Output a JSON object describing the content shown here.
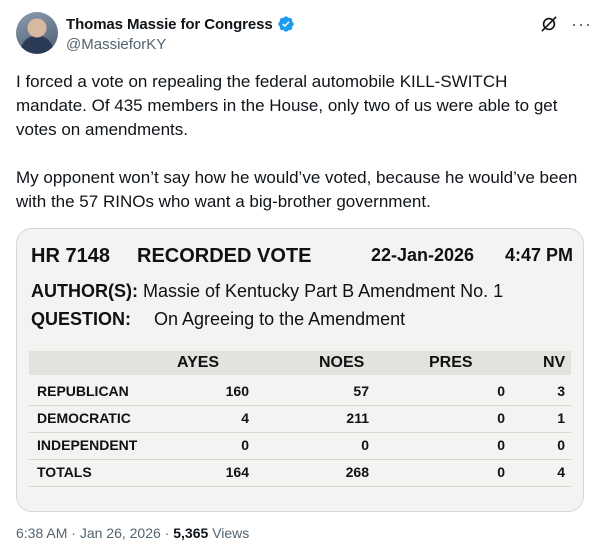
{
  "author": {
    "display_name": "Thomas Massie for Congress",
    "handle": "@MassieforKY",
    "verified_color": "#1d9bf0"
  },
  "icons": {
    "verified": "verified-badge-icon",
    "grok": "grok-icon",
    "more": "more-options-icon"
  },
  "tweet": {
    "paragraph1": "I forced a vote on repealing the federal automobile KILL-SWITCH mandate. Of 435 members in the House, only two of us were able to get votes on amendments.",
    "paragraph2": "My opponent won’t say how he would’ve voted, because he would’ve been with the 57 RINOs who want a big-brother government."
  },
  "vote_card": {
    "bill": "HR 7148",
    "title": "RECORDED VOTE",
    "date": "22-Jan-2026",
    "time": "4:47 PM",
    "author_label": "AUTHOR(S):",
    "author_value": "Massie of Kentucky Part B Amendment No. 1",
    "question_label": "QUESTION:",
    "question_value": "On Agreeing to the Amendment",
    "columns": [
      "AYES",
      "NOES",
      "PRES",
      "NV"
    ],
    "rows": [
      {
        "party": "REPUBLICAN",
        "ayes": "160",
        "noes": "57",
        "pres": "0",
        "nv": "3"
      },
      {
        "party": "DEMOCRATIC",
        "ayes": "4",
        "noes": "211",
        "pres": "0",
        "nv": "1"
      },
      {
        "party": "INDEPENDENT",
        "ayes": "0",
        "noes": "0",
        "pres": "0",
        "nv": "0"
      },
      {
        "party": "TOTALS",
        "ayes": "164",
        "noes": "268",
        "pres": "0",
        "nv": "4"
      }
    ]
  },
  "meta": {
    "time": "6:38 AM",
    "sep1": "·",
    "date": "Jan 26, 2026",
    "sep2": "·",
    "views_count": "5,365",
    "views_label": "Views"
  }
}
